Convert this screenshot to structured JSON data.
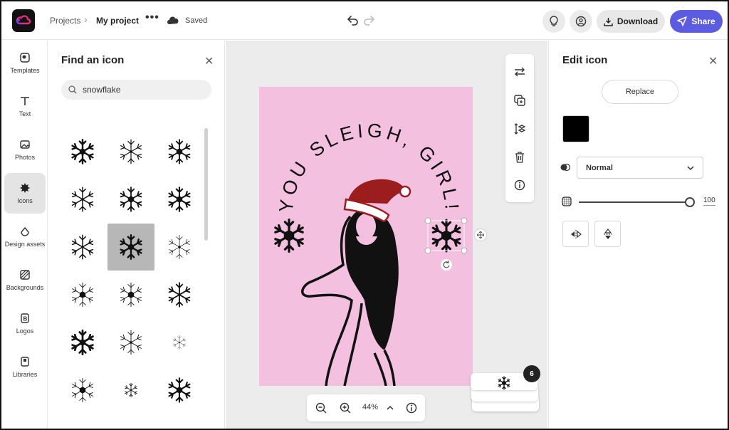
{
  "header": {
    "breadcrumb_root": "Projects",
    "project_name": "My project",
    "more": "•••",
    "save_status": "Saved",
    "download_label": "Download",
    "share_label": "Share"
  },
  "rail": {
    "items": [
      {
        "label": "Templates",
        "icon": "templates-icon"
      },
      {
        "label": "Text",
        "icon": "text-icon"
      },
      {
        "label": "Photos",
        "icon": "photos-icon"
      },
      {
        "label": "Icons",
        "icon": "icons-icon",
        "active": true
      },
      {
        "label": "Design assets",
        "icon": "design-assets-icon"
      },
      {
        "label": "Backgrounds",
        "icon": "backgrounds-icon"
      },
      {
        "label": "Logos",
        "icon": "logos-icon"
      },
      {
        "label": "Libraries",
        "icon": "libraries-icon"
      }
    ]
  },
  "find_panel": {
    "title": "Find an icon",
    "search_value": "snowflake",
    "results_count": 18,
    "selected_index": 7
  },
  "artboard": {
    "headline": "YOU SLEIGH, GIRL!",
    "background": "#f3c1df",
    "hat_color": "#9b1d1d"
  },
  "canvas": {
    "zoom": "44%",
    "page_count": "6"
  },
  "edit_panel": {
    "title": "Edit icon",
    "replace_label": "Replace",
    "fill_color": "#000000",
    "blend_mode": "Normal",
    "opacity": "100",
    "opacity_fraction": 1.0
  },
  "colors": {
    "accent": "#5c5ce0",
    "selected_cell": "#b7b7b7"
  }
}
